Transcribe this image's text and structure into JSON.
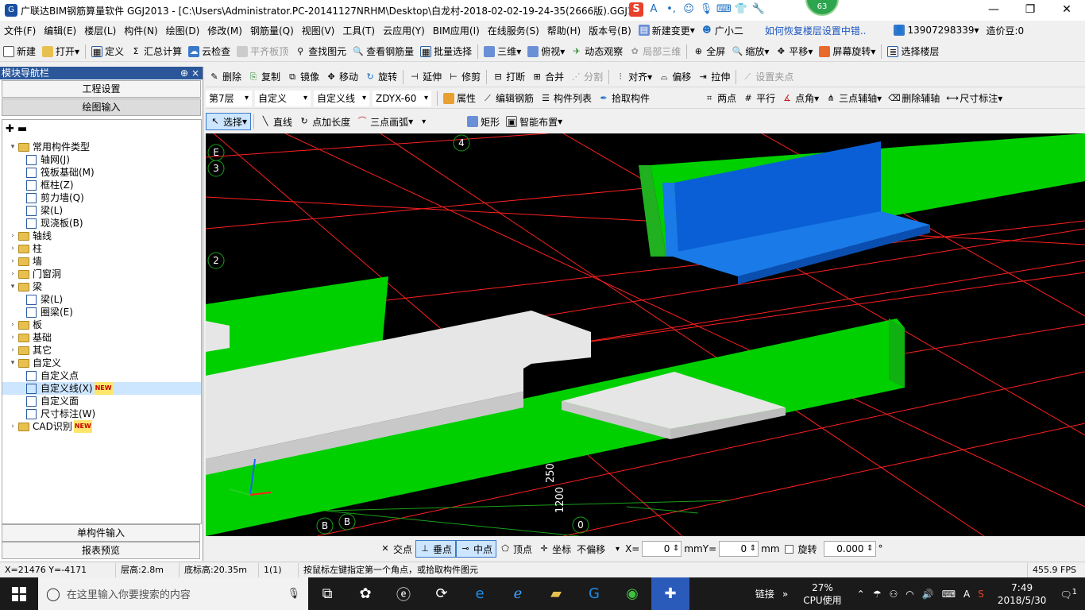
{
  "window": {
    "title": "广联达BIM钢筋算量软件 GGJ2013 - [C:\\Users\\Administrator.PC-20141127NRHM\\Desktop\\白龙村-2018-02-02-19-24-35(2666版).GGJ12]",
    "badge": "63",
    "minimize": "—",
    "restore": "❐",
    "close": "✕"
  },
  "menubar": {
    "items": [
      "文件(F)",
      "编辑(E)",
      "楼层(L)",
      "构件(N)",
      "绘图(D)",
      "修改(M)",
      "钢筋量(Q)",
      "视图(V)",
      "工具(T)",
      "云应用(Y)",
      "BIM应用(I)",
      "在线服务(S)",
      "帮助(H)",
      "版本号(B)"
    ],
    "new_change": "新建变更",
    "xiaoer": "广小二",
    "help_link": "如何恢复楼层设置中错..",
    "phone": "13907298339",
    "price_bean": "造价豆:0"
  },
  "toolbar1": {
    "new": "新建",
    "open": "打开",
    "define": "定义",
    "sum": "汇总计算",
    "cloud_check": "云检查",
    "flat_top": "平齐板顶",
    "find": "查找图元",
    "view_rebar": "查看钢筋量",
    "batch_select": "批量选择",
    "three_d": "三维",
    "top_view": "俯视",
    "dyn_view": "动态观察",
    "local_3d": "局部三维",
    "fullscreen": "全屏",
    "zoom": "缩放",
    "pan": "平移",
    "rotate_screen": "屏幕旋转",
    "select_floor": "选择楼层"
  },
  "toolbar2": {
    "delete": "删除",
    "copy": "复制",
    "mirror": "镜像",
    "move": "移动",
    "rotate": "旋转",
    "extend": "延伸",
    "trim": "修剪",
    "break": "打断",
    "merge": "合并",
    "split": "分割",
    "align": "对齐",
    "offset": "偏移",
    "stretch": "拉伸",
    "set_grip": "设置夹点"
  },
  "toolbar3": {
    "floor": "第7层",
    "category": "自定义",
    "type": "自定义线",
    "component": "ZDYX-60",
    "props": "属性",
    "edit_rebar": "编辑钢筋",
    "comp_list": "构件列表",
    "pick": "拾取构件",
    "two_pt": "两点",
    "parallel": "平行",
    "angle": "点角",
    "three_pt_axis": "三点辅轴",
    "del_axis": "删除辅轴",
    "dim": "尺寸标注"
  },
  "toolbar4": {
    "select": "选择",
    "line": "直线",
    "pt_len": "点加长度",
    "arc": "三点画弧",
    "rect": "矩形",
    "smart": "智能布置"
  },
  "sidebar": {
    "title": "模块导航栏",
    "pin": "⊕",
    "close": "×",
    "btn_project": "工程设置",
    "btn_draw": "绘图输入",
    "btn_single": "单构件输入",
    "btn_report": "报表预览",
    "tree": [
      {
        "label": "常用构件类型",
        "level": 0,
        "type": "folder",
        "open": true
      },
      {
        "label": "轴网(J)",
        "level": 1,
        "type": "item"
      },
      {
        "label": "筏板基础(M)",
        "level": 1,
        "type": "item"
      },
      {
        "label": "框柱(Z)",
        "level": 1,
        "type": "item"
      },
      {
        "label": "剪力墙(Q)",
        "level": 1,
        "type": "item"
      },
      {
        "label": "梁(L)",
        "level": 1,
        "type": "item"
      },
      {
        "label": "现浇板(B)",
        "level": 1,
        "type": "item"
      },
      {
        "label": "轴线",
        "level": 0,
        "type": "folder",
        "open": false
      },
      {
        "label": "柱",
        "level": 0,
        "type": "folder",
        "open": false
      },
      {
        "label": "墙",
        "level": 0,
        "type": "folder",
        "open": false
      },
      {
        "label": "门窗洞",
        "level": 0,
        "type": "folder",
        "open": false
      },
      {
        "label": "梁",
        "level": 0,
        "type": "folder",
        "open": true
      },
      {
        "label": "梁(L)",
        "level": 1,
        "type": "item"
      },
      {
        "label": "圈梁(E)",
        "level": 1,
        "type": "item"
      },
      {
        "label": "板",
        "level": 0,
        "type": "folder",
        "open": false
      },
      {
        "label": "基础",
        "level": 0,
        "type": "folder",
        "open": false
      },
      {
        "label": "其它",
        "level": 0,
        "type": "folder",
        "open": false
      },
      {
        "label": "自定义",
        "level": 0,
        "type": "folder",
        "open": true
      },
      {
        "label": "自定义点",
        "level": 1,
        "type": "item"
      },
      {
        "label": "自定义线(X)",
        "level": 1,
        "type": "item",
        "selected": true,
        "new": true
      },
      {
        "label": "自定义面",
        "level": 1,
        "type": "item"
      },
      {
        "label": "尺寸标注(W)",
        "level": 1,
        "type": "item"
      },
      {
        "label": "CAD识别",
        "level": 0,
        "type": "folder",
        "open": false,
        "new": true
      }
    ],
    "new_tag": "NEW"
  },
  "viewport": {
    "axis_labels": {
      "e": "E",
      "n3": "3",
      "n2": "2",
      "n4": "4",
      "b1": "B",
      "b2": "B",
      "n0": "0"
    },
    "dim1": "250",
    "dim2": "1200"
  },
  "snapbar": {
    "intersect": "交点",
    "perp": "垂点",
    "mid": "中点",
    "vertex": "顶点",
    "coord": "坐标",
    "offset_mode": "不偏移",
    "x_label": "X=",
    "x_val": "0",
    "y_label": "Y=",
    "y_val": "0",
    "unit": "mm",
    "rotate": "旋转",
    "rot_val": "0.000",
    "deg": "°"
  },
  "statusbar": {
    "coords": "X=21476 Y=-4171",
    "floor_h": "层高:2.8m",
    "base_h": "底标高:20.35m",
    "count": "1(1)",
    "hint": "按鼠标左键指定第一个角点，或拾取构件图元",
    "fps": "455.9 FPS"
  },
  "taskbar": {
    "search": "在这里输入你要搜索的内容",
    "link": "链接",
    "cpu_pct": "27%",
    "cpu_label": "CPU使用",
    "time": "7:49",
    "date": "2018/5/30",
    "notif": "1"
  }
}
